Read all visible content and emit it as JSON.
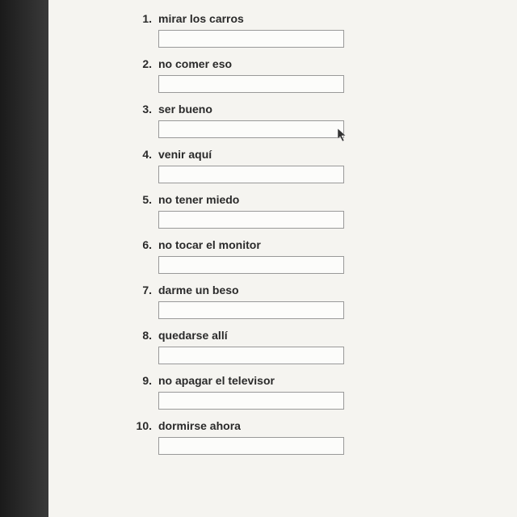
{
  "questions": [
    {
      "number": "1.",
      "prompt": "mirar los carros",
      "value": ""
    },
    {
      "number": "2.",
      "prompt": "no comer eso",
      "value": ""
    },
    {
      "number": "3.",
      "prompt": "ser bueno",
      "value": ""
    },
    {
      "number": "4.",
      "prompt": "venir aquí",
      "value": ""
    },
    {
      "number": "5.",
      "prompt": "no tener miedo",
      "value": ""
    },
    {
      "number": "6.",
      "prompt": "no tocar el monitor",
      "value": ""
    },
    {
      "number": "7.",
      "prompt": "darme un beso",
      "value": ""
    },
    {
      "number": "8.",
      "prompt": "quedarse allí",
      "value": ""
    },
    {
      "number": "9.",
      "prompt": "no apagar el televisor",
      "value": ""
    },
    {
      "number": "10.",
      "prompt": "dormirse ahora",
      "value": ""
    }
  ]
}
